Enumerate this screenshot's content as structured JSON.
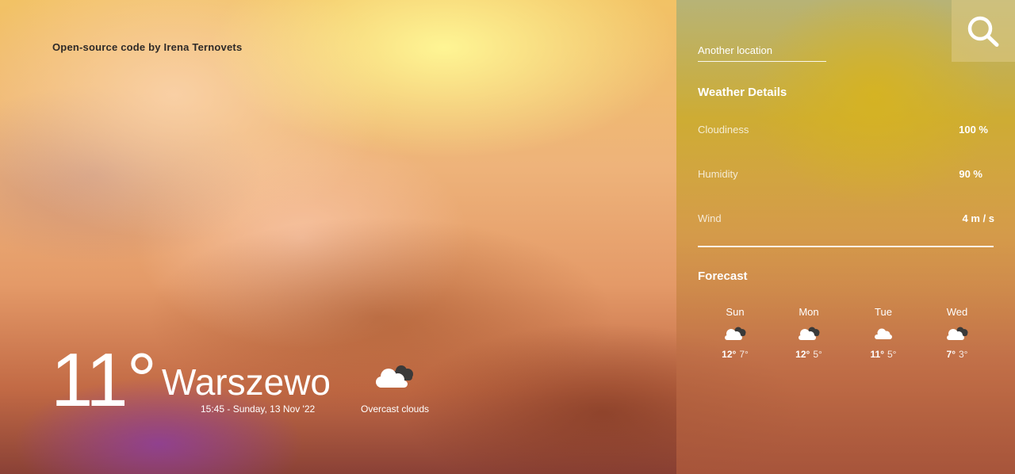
{
  "credit": "Open-source code by Irena Ternovets",
  "current": {
    "temperature": "11°",
    "city": "Warszewo",
    "datetime": "15:45 - Sunday, 13 Nov '22",
    "condition": "Overcast clouds",
    "icon": "overcast-clouds-icon"
  },
  "panel": {
    "search_placeholder": "Another location",
    "search_icon": "search-icon",
    "details_title": "Weather Details",
    "details": [
      {
        "label": "Cloudiness",
        "value": "100 %"
      },
      {
        "label": "Humidity",
        "value": "90 %"
      },
      {
        "label": "Wind",
        "value": "4 m / s"
      }
    ],
    "forecast_title": "Forecast",
    "forecast": [
      {
        "day": "Sun",
        "high": "12°",
        "low": "7°",
        "icon": "overcast-clouds-icon"
      },
      {
        "day": "Mon",
        "high": "12°",
        "low": "5°",
        "icon": "overcast-clouds-icon"
      },
      {
        "day": "Tue",
        "high": "11°",
        "low": "5°",
        "icon": "cloud-icon"
      },
      {
        "day": "Wed",
        "high": "7°",
        "low": "3°",
        "icon": "overcast-clouds-icon"
      }
    ]
  }
}
